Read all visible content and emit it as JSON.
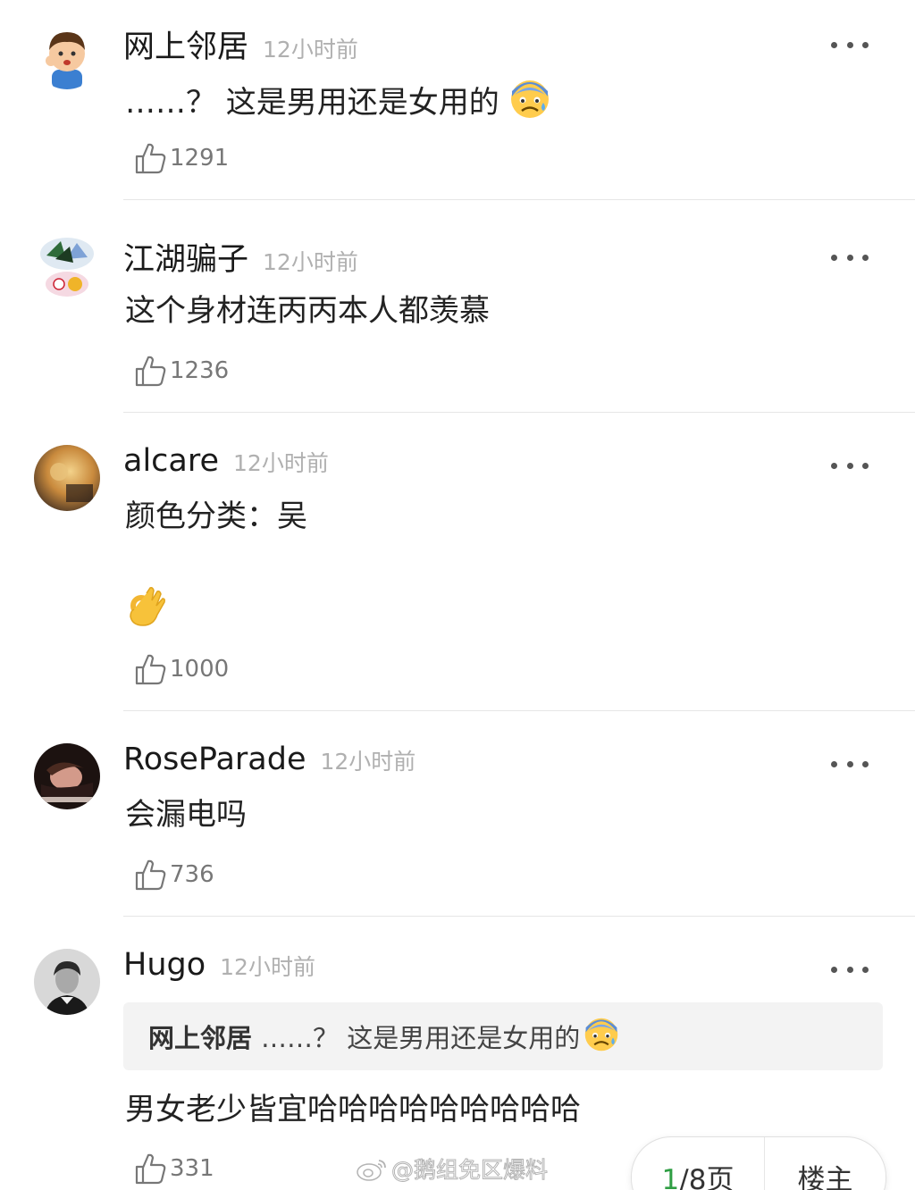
{
  "comments": [
    {
      "username": "网上邻居",
      "time": "12小时前",
      "text": "……？ 这是男用还是女用的",
      "text_emoji": "anxious-sweat-face-emoji",
      "likes": "1291",
      "avatar_icon": "cartoon-boy-avatar"
    },
    {
      "username": "江湖骗子",
      "time": "12小时前",
      "text": "这个身材连丙丙本人都羡慕",
      "likes": "1236",
      "avatar_icon": "sticker-collage-avatar"
    },
    {
      "username": "alcare",
      "time": "12小时前",
      "text": "颜色分类：吴",
      "text_emoji": "ok-hand-emoji",
      "likes": "1000",
      "avatar_icon": "photo-avatar"
    },
    {
      "username": "RoseParade",
      "time": "12小时前",
      "text": "会漏电吗",
      "likes": "736",
      "avatar_icon": "photo-avatar"
    },
    {
      "username": "Hugo",
      "time": "12小时前",
      "quote": {
        "username": "网上邻居",
        "text": "……？ 这是男用还是女用的",
        "text_emoji": "anxious-sweat-face-emoji"
      },
      "text": "男女老少皆宜哈哈哈哈哈哈哈哈哈",
      "likes": "331",
      "avatar_icon": "portrait-photo-avatar"
    }
  ],
  "watermark": {
    "text": "@鹅组免区爆料",
    "icon": "weibo-logo-icon"
  },
  "pager": {
    "current": "1",
    "total": "/8页",
    "op_label": "楼主"
  },
  "colors": {
    "username": "#1a1a1a",
    "time": "#b0b0b0",
    "like_count": "#777777",
    "pager_current": "#2f9e44",
    "quote_bg": "#f3f3f3",
    "divider": "#e6e6e6"
  }
}
